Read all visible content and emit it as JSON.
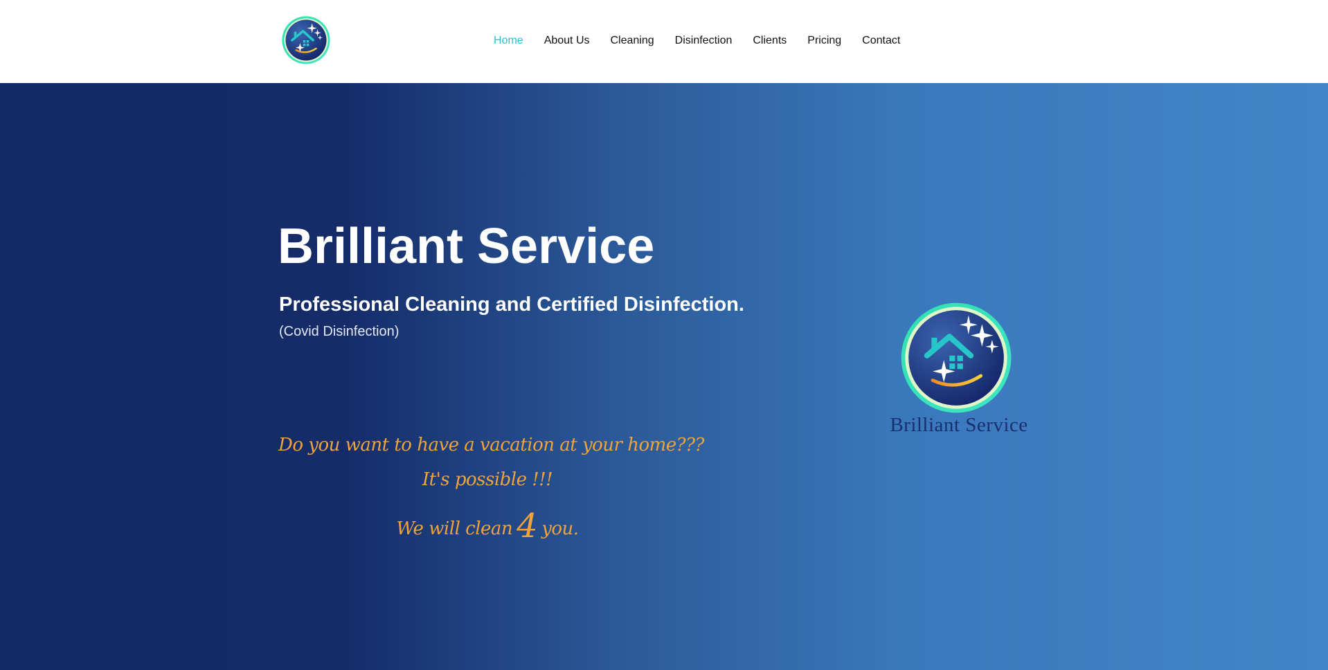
{
  "header": {
    "logo_icon": "brilliant-service-house-logo-icon",
    "nav": [
      {
        "label": "Home",
        "active": true
      },
      {
        "label": "About Us",
        "active": false
      },
      {
        "label": "Cleaning",
        "active": false
      },
      {
        "label": "Disinfection",
        "active": false
      },
      {
        "label": "Clients",
        "active": false
      },
      {
        "label": "Pricing",
        "active": false
      },
      {
        "label": "Contact",
        "active": false
      }
    ]
  },
  "hero": {
    "title": "Brilliant Service",
    "subtitle": "Professional Cleaning and Certified Disinfection.",
    "note": "(Covid Disinfection)",
    "tagline": {
      "line1": "Do you want to have a vacation at your home???",
      "line2": "It's possible !!!",
      "line3_before": "We will clean",
      "line3_number": "4",
      "line3_after": "you."
    },
    "logo_icon": "brilliant-service-house-logo-icon",
    "brand_name": "Brilliant Service"
  },
  "colors": {
    "nav_active": "#27c3d0",
    "nav_text": "#111111",
    "hero_gradient_start": "#142a66",
    "hero_gradient_end": "#4186c8",
    "tagline": "#f0a33a",
    "brand_text": "#1a2f6e"
  }
}
